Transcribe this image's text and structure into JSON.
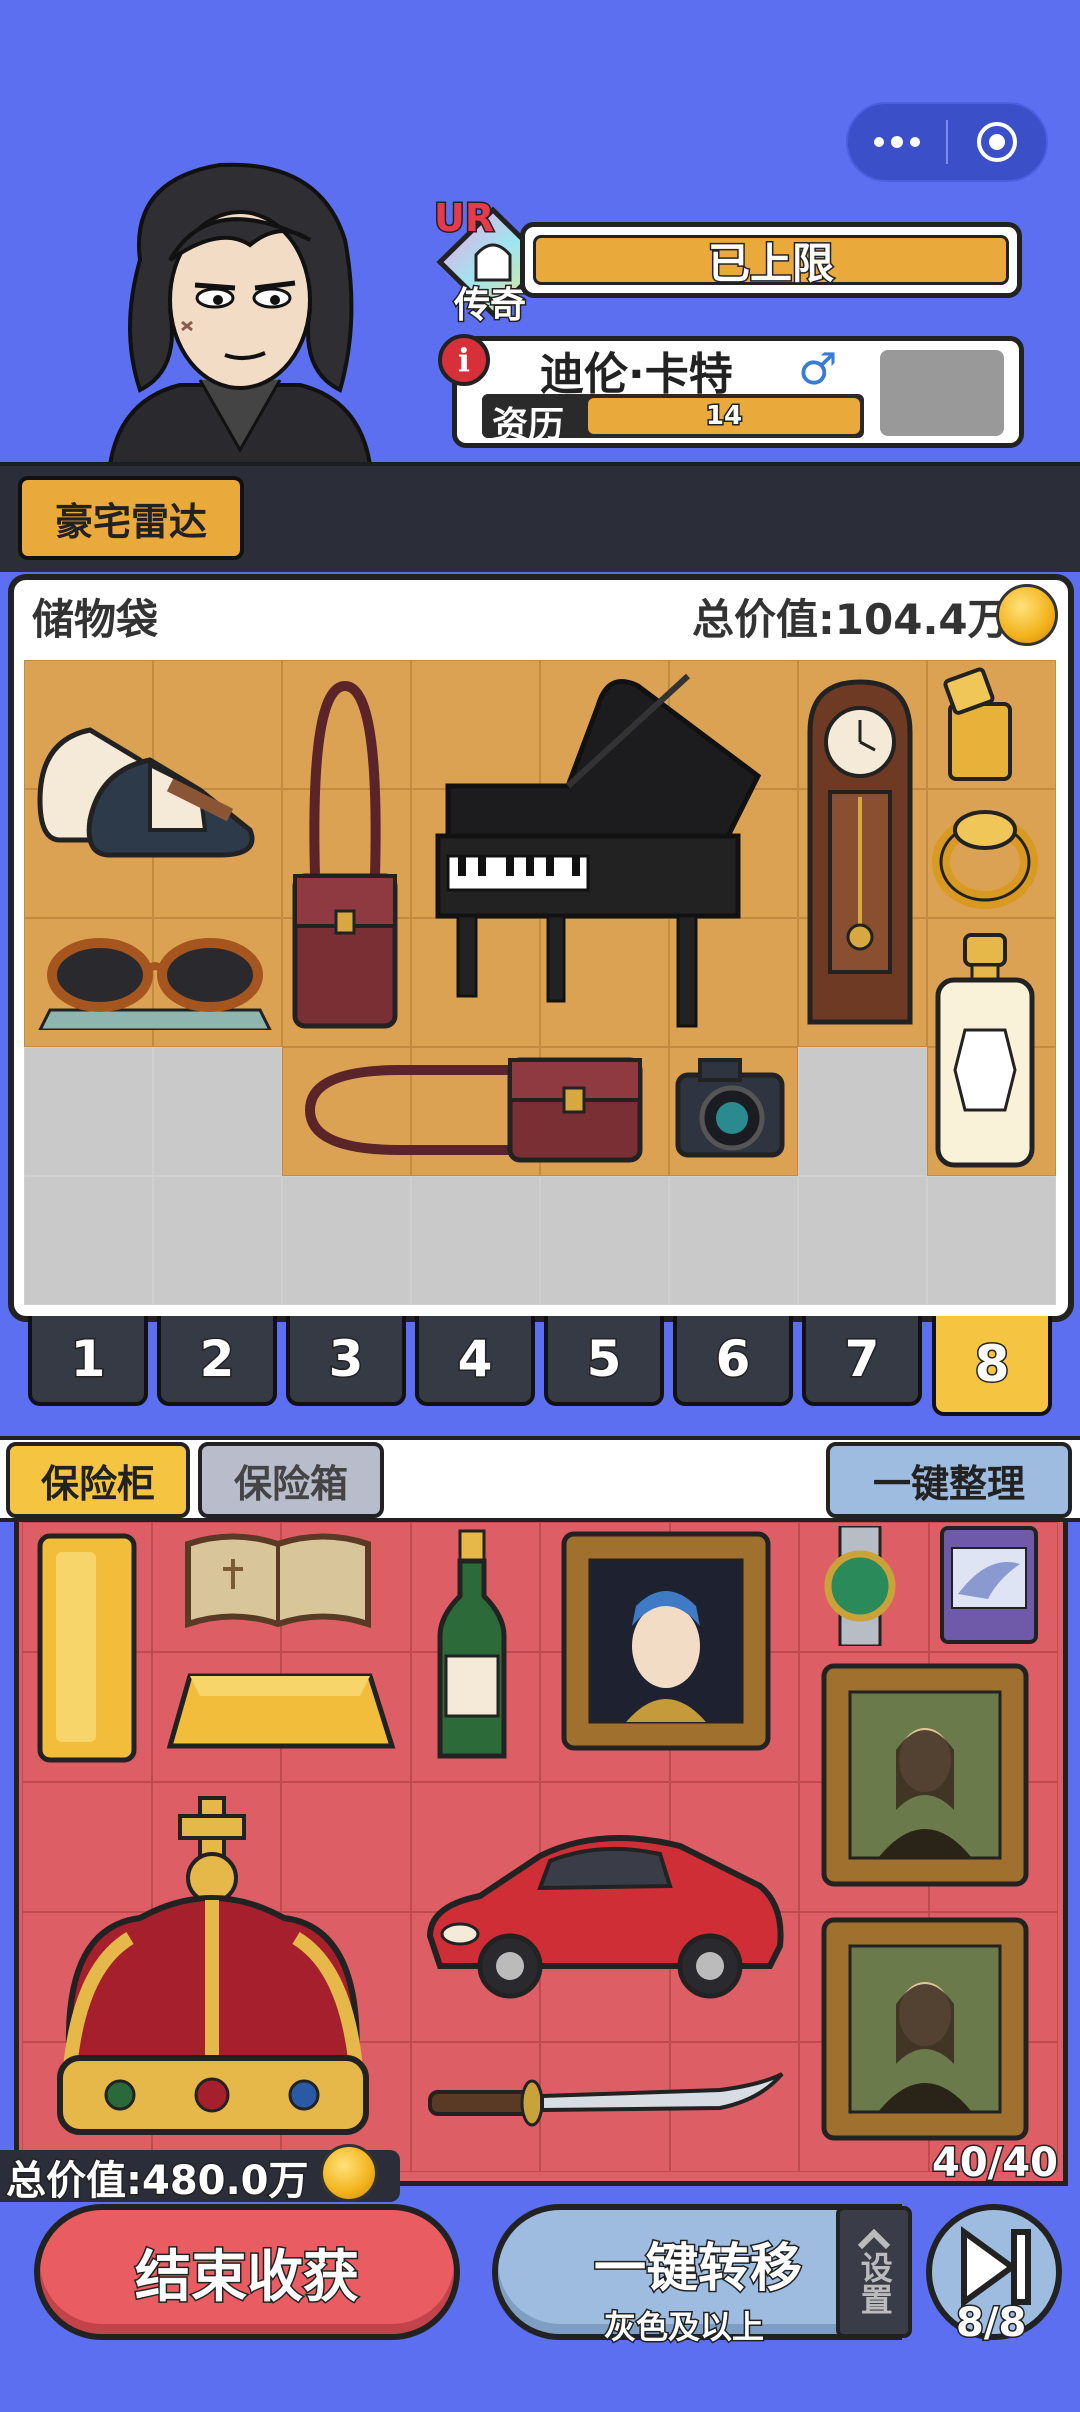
{
  "capsule": {
    "menu_icon": "more-dots-icon",
    "close_icon": "target-circle-icon"
  },
  "character": {
    "rarity_code": "UR",
    "rarity_name": "传奇",
    "level_text": "已上限",
    "name": "迪伦·卡特",
    "gender_symbol": "♂",
    "experience_label": "资历",
    "experience_value": "14"
  },
  "radar_button": "豪宅雷达",
  "storage": {
    "title": "储物袋",
    "total_value": "总价值:104.4万",
    "items": [
      "sneakers",
      "handbag",
      "grand-piano",
      "grandfather-clock",
      "lighter",
      "gold-ring",
      "sunglasses",
      "perfume",
      "shoulder-bag",
      "camera"
    ]
  },
  "pages": [
    "1",
    "2",
    "3",
    "4",
    "5",
    "6",
    "7",
    "8"
  ],
  "active_page": "8",
  "vault": {
    "tabs": [
      "保险柜",
      "保险箱"
    ],
    "sort_button": "一键整理",
    "total_value": "总价值:480.0万",
    "count": "40/40",
    "items": [
      "gold-bar",
      "ancient-book",
      "gold-ingot",
      "champagne",
      "pearl-earring-painting",
      "watch",
      "trading-card",
      "mona-lisa",
      "royal-crown",
      "red-sports-car",
      "mona-lisa",
      "katana"
    ]
  },
  "buttons": {
    "end": "结束收获",
    "transfer": "一键转移",
    "transfer_sub": "灰色及以上",
    "settings": "设置",
    "skip_count": "8/8"
  },
  "colors": {
    "background": "#5b6ff0",
    "gold": "#e9a93b",
    "vault_red": "#dd5f65",
    "active_tab": "#f5c542"
  }
}
